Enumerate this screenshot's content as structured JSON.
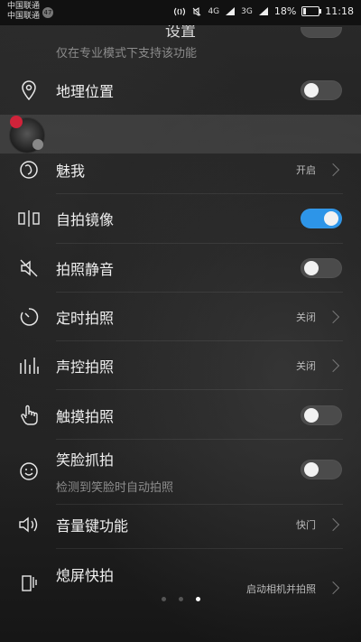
{
  "status_bar": {
    "carrier_1": "中国联通",
    "carrier_2": "中国联通",
    "carrier_badge": "47",
    "network_1": "4G",
    "network_2": "3G",
    "battery": "18%",
    "time": "11:18"
  },
  "header": {
    "title": "设置"
  },
  "settings": {
    "pro_mode_note": "仅在专业模式下支持该功能",
    "location": {
      "label": "地理位置",
      "enabled": false
    },
    "beauty": {
      "label": "魅我",
      "value": "开启"
    },
    "selfie_mirror": {
      "label": "自拍镜像",
      "enabled": true
    },
    "mute_shutter": {
      "label": "拍照静音",
      "enabled": false
    },
    "timer": {
      "label": "定时拍照",
      "value": "关闭"
    },
    "voice_shutter": {
      "label": "声控拍照",
      "value": "关闭"
    },
    "touch_capture": {
      "label": "触摸拍照",
      "enabled": false
    },
    "smile_capture": {
      "label": "笑脸抓拍",
      "subtitle": "检测到笑脸时自动拍照",
      "enabled": false
    },
    "volume_key": {
      "label": "音量键功能",
      "value": "快门"
    },
    "ultra_snapshot": {
      "label": "熄屏快拍",
      "value": "启动相机并拍照"
    }
  },
  "pager": {
    "count": 3,
    "active": 3
  },
  "colors": {
    "toggle_on": "#2d95e8",
    "toggle_off": "#4b4b4b",
    "badge": "#d0233a"
  }
}
